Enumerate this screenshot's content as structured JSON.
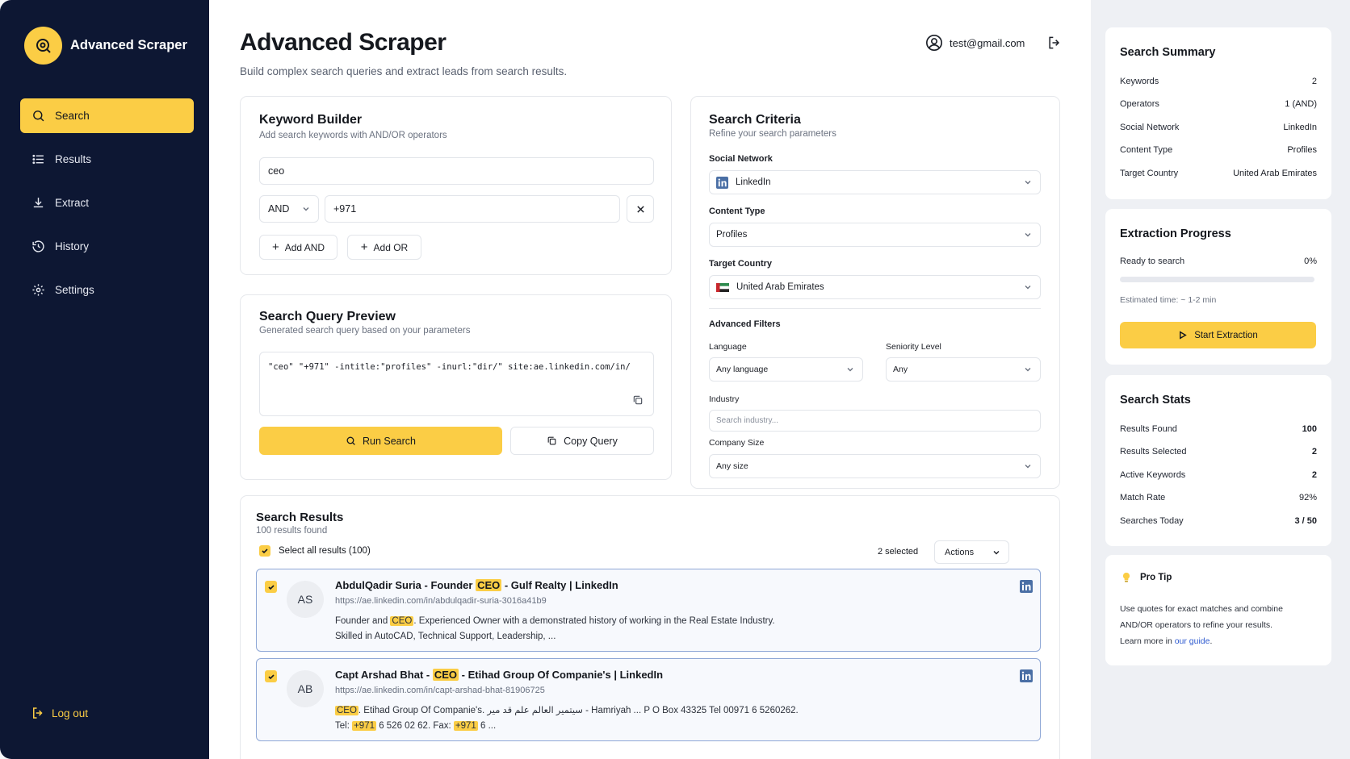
{
  "app": {
    "name": "Advanced Scraper"
  },
  "sidebar": {
    "items": [
      {
        "label": "Search"
      },
      {
        "label": "Results"
      },
      {
        "label": "Extract"
      },
      {
        "label": "History"
      },
      {
        "label": "Settings"
      }
    ],
    "logout": "Log out"
  },
  "header": {
    "title": "Advanced Scraper",
    "subtitle": "Build complex search queries and extract leads from search results.",
    "user_email": "test@gmail.com"
  },
  "keyword_builder": {
    "title": "Keyword Builder",
    "subtitle": "Add search keywords with AND/OR operators",
    "keyword1": "ceo",
    "operator": "AND",
    "keyword2": "+971",
    "add_and": "Add AND",
    "add_or": "Add OR"
  },
  "query_preview": {
    "title": "Search Query Preview",
    "subtitle": "Generated search query based on your parameters",
    "query": "\"ceo\" \"+971\" -intitle:\"profiles\" -inurl:\"dir/\" site:ae.linkedin.com/in/",
    "run_search": "Run Search",
    "copy_query": "Copy Query"
  },
  "criteria": {
    "title": "Search Criteria",
    "subtitle": "Refine your search parameters",
    "social_network_label": "Social Network",
    "social_network": "LinkedIn",
    "content_type_label": "Content Type",
    "content_type": "Profiles",
    "target_country_label": "Target Country",
    "target_country": "United Arab Emirates",
    "advanced_filters": "Advanced Filters",
    "language_label": "Language",
    "language": "Any language",
    "seniority_label": "Seniority Level",
    "seniority": "Any",
    "industry_label": "Industry",
    "industry_placeholder": "Search industry...",
    "company_size_label": "Company Size",
    "company_size": "Any size"
  },
  "results": {
    "title": "Search Results",
    "count_text": "100 results found",
    "select_all": "Select all results (100)",
    "selected": "2 selected",
    "actions": "Actions",
    "items": [
      {
        "initials": "AS",
        "title_pre": "AbdulQadir Suria - Founder ",
        "title_hl": "CEO",
        "title_post": " - Gulf Realty | LinkedIn",
        "url": "https://ae.linkedin.com/in/abdulqadir-suria-3016a41b9",
        "d1_pre": "Founder and ",
        "d1_hl": "CEO",
        "d1_post": ". Experienced Owner with a demonstrated history of working in the Real Estate Industry.",
        "d2": "Skilled in AutoCAD, Technical Support, Leadership, ..."
      },
      {
        "initials": "AB",
        "title_pre": "Capt Arshad Bhat - ",
        "title_hl": "CEO",
        "title_post": " - Etihad Group Of Companie's | LinkedIn",
        "url": "https://ae.linkedin.com/in/capt-arshad-bhat-81906725",
        "d1_hl": "CEO",
        "d1_post": ". Etihad Group Of Companie's. سيتمير العالم علم قد مير - Hamriyah ... P O Box 43325 Tel 00971 6 5260262.",
        "d2_pre": "Tel: ",
        "d2_hl1": "+971",
        "d2_mid": " 6 526 02 62. Fax: ",
        "d2_hl2": "+971",
        "d2_post": " 6 ..."
      }
    ]
  },
  "summary": {
    "title": "Search Summary",
    "rows": [
      {
        "k": "Keywords",
        "v": "2"
      },
      {
        "k": "Operators",
        "v": "1 (AND)"
      },
      {
        "k": "Social Network",
        "v": "LinkedIn"
      },
      {
        "k": "Content Type",
        "v": "Profiles"
      },
      {
        "k": "Target Country",
        "v": "United Arab Emirates"
      }
    ]
  },
  "extraction": {
    "title": "Extraction Progress",
    "status": "Ready to search",
    "percent_text": "0%",
    "progress": 0,
    "estimate": "Estimated time: ~ 1-2 min",
    "start": "Start Extraction"
  },
  "stats": {
    "title": "Search Stats",
    "rows": [
      {
        "k": "Results Found",
        "v": "100"
      },
      {
        "k": "Results Selected",
        "v": "2"
      },
      {
        "k": "Active Keywords",
        "v": "2"
      },
      {
        "k": "Match Rate",
        "v": "92%"
      },
      {
        "k": "Searches Today",
        "v": "3 / 50"
      }
    ]
  },
  "tip": {
    "title": "Pro Tip",
    "line1": "Use quotes for exact matches and combine",
    "line2": "AND/OR operators to refine your results.",
    "line3_pre": "Learn more in ",
    "link": "our guide",
    "line3_post": "."
  },
  "colors": {
    "accent": "#fbcd45",
    "sidebar": "#0d1733",
    "link": "#2f5bd0"
  }
}
